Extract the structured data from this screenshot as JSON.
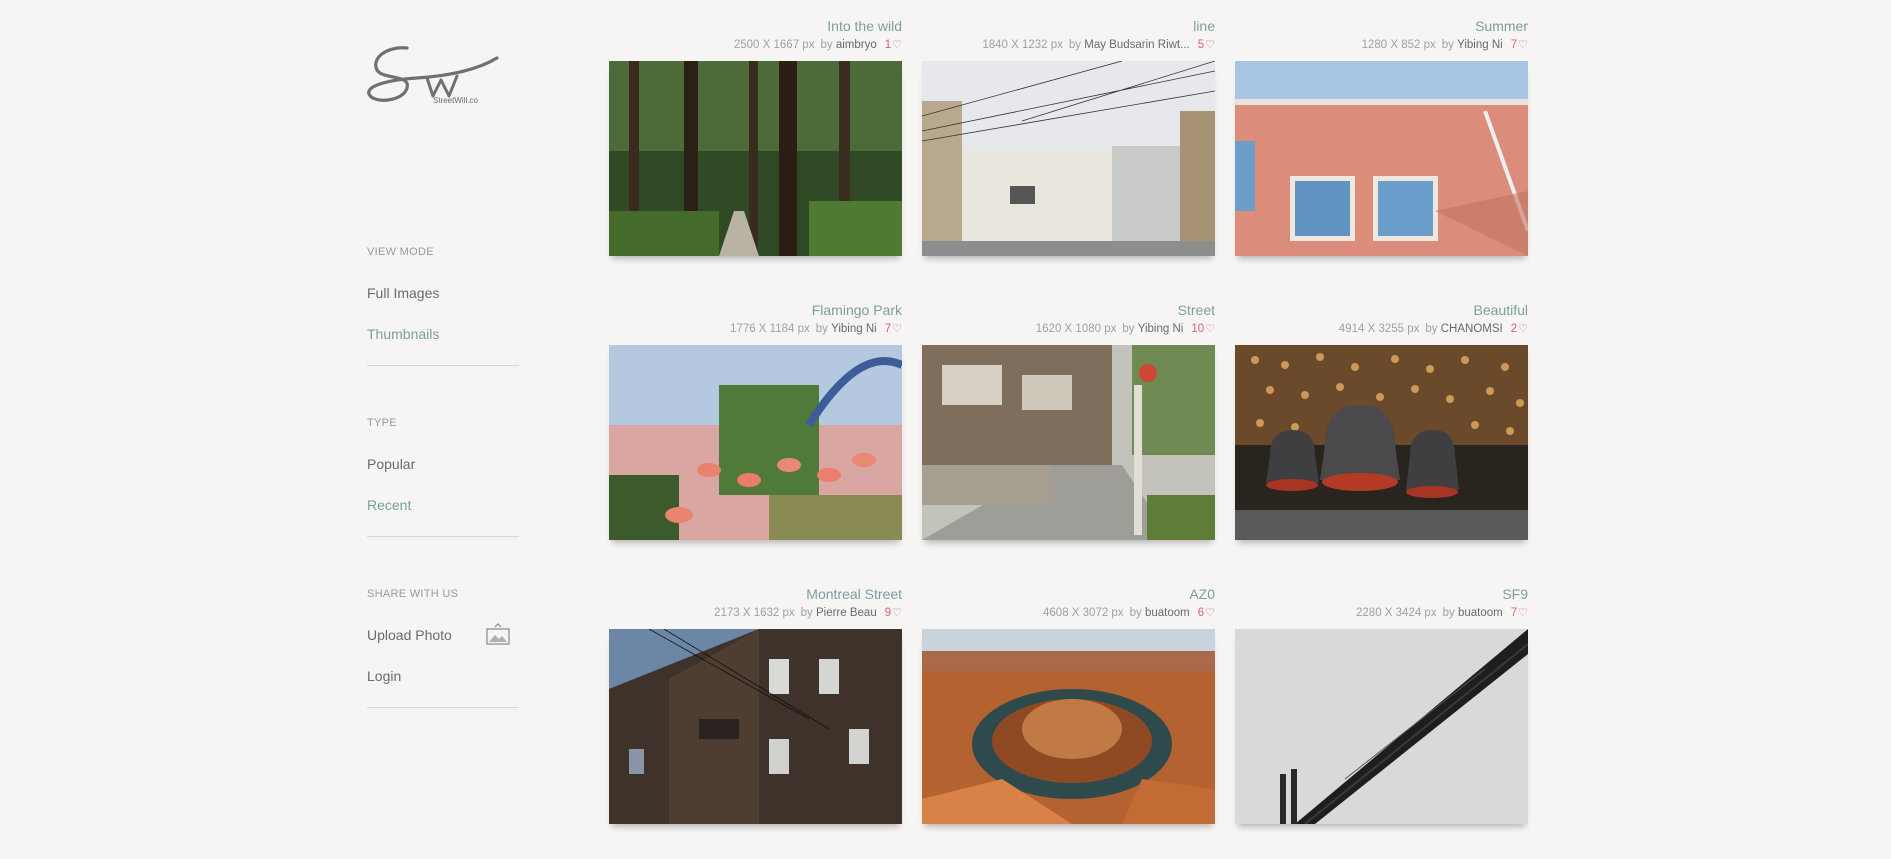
{
  "brand": {
    "logo_text": "Sw",
    "logo_sub": "StreetWill.co"
  },
  "sidebar": {
    "view_mode": {
      "label": "VIEW MODE",
      "items": [
        {
          "label": "Full Images",
          "active": false
        },
        {
          "label": "Thumbnails",
          "active": true
        }
      ]
    },
    "type": {
      "label": "TYPE",
      "items": [
        {
          "label": "Popular",
          "active": false
        },
        {
          "label": "Recent",
          "active": true
        }
      ]
    },
    "share": {
      "label": "SHARE WITH US",
      "upload_label": "Upload Photo",
      "upload_icon": "image-upload-icon",
      "login_label": "Login"
    }
  },
  "photos": [
    {
      "title": "Into the wild",
      "dimensions": "2500 X 1667 px",
      "by": "by",
      "author": "aimbryo",
      "likes": "1",
      "scene": "forest"
    },
    {
      "title": "line",
      "dimensions": "1840 X 1232 px",
      "by": "by",
      "author": "May Budsarin Riwt...",
      "likes": "5",
      "scene": "street-wires"
    },
    {
      "title": "Summer",
      "dimensions": "1280 X 852 px",
      "by": "by",
      "author": "Yibing Ni",
      "likes": "7",
      "scene": "brick-wall"
    },
    {
      "title": "Flamingo Park",
      "dimensions": "1776 X 1184 px",
      "by": "by",
      "author": "Yibing Ni",
      "likes": "7",
      "scene": "flamingos"
    },
    {
      "title": "Street",
      "dimensions": "1620 X 1080 px",
      "by": "by",
      "author": "Yibing Ni",
      "likes": "10",
      "scene": "japan-street"
    },
    {
      "title": "Beautiful",
      "dimensions": "4914 X 3255 px",
      "by": "by",
      "author": "CHANOMSI",
      "likes": "2",
      "scene": "bells"
    },
    {
      "title": "Montreal Street",
      "dimensions": "2173 X 1632 px",
      "by": "by",
      "author": "Pierre Beau",
      "likes": "9",
      "scene": "building"
    },
    {
      "title": "AZ0",
      "dimensions": "4608 X 3072 px",
      "by": "by",
      "author": "buatoom",
      "likes": "6",
      "scene": "canyon"
    },
    {
      "title": "SF9",
      "dimensions": "2280 X 3424 px",
      "by": "by",
      "author": "buatoom",
      "likes": "7",
      "scene": "bridge"
    }
  ],
  "colors": {
    "accent": "#7a9ea0",
    "like": "#d65f7f",
    "background": "#f7f5f3"
  }
}
